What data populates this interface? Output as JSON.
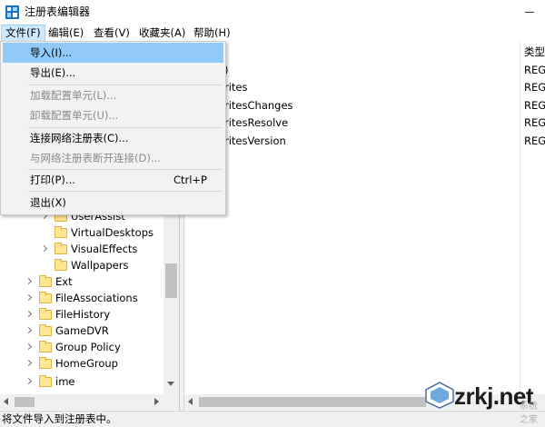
{
  "window": {
    "title": "注册表编辑器"
  },
  "menubar": {
    "items": [
      "文件(F)",
      "编辑(E)",
      "查看(V)",
      "收藏夹(A)",
      "帮助(H)"
    ]
  },
  "file_menu": {
    "items": [
      {
        "label": "导入(I)...",
        "shortcut": "",
        "state": "highlighted"
      },
      {
        "label": "导出(E)...",
        "shortcut": "",
        "state": "enabled"
      },
      {
        "label": "加载配置单元(L)...",
        "shortcut": "",
        "state": "disabled"
      },
      {
        "label": "卸载配置单元(U)...",
        "shortcut": "",
        "state": "disabled"
      },
      {
        "label": "连接网络注册表(C)...",
        "shortcut": "",
        "state": "enabled"
      },
      {
        "label": "与网络注册表断开连接(D)...",
        "shortcut": "",
        "state": "disabled"
      },
      {
        "label": "打印(P)...",
        "shortcut": "Ctrl+P",
        "state": "enabled"
      },
      {
        "label": "退出(X)",
        "shortcut": "",
        "state": "enabled"
      }
    ]
  },
  "tree": {
    "items": [
      {
        "label": "UserAssist",
        "expandable": true
      },
      {
        "label": "VirtualDesktops",
        "expandable": false
      },
      {
        "label": "VisualEffects",
        "expandable": true
      },
      {
        "label": "Wallpapers",
        "expandable": false
      },
      {
        "label": "Ext",
        "expandable": true
      },
      {
        "label": "FileAssociations",
        "expandable": true
      },
      {
        "label": "FileHistory",
        "expandable": true
      },
      {
        "label": "GameDVR",
        "expandable": true
      },
      {
        "label": "Group Policy",
        "expandable": true
      },
      {
        "label": "HomeGroup",
        "expandable": true
      },
      {
        "label": "ime",
        "expandable": true
      }
    ]
  },
  "values_pane": {
    "type_header": "类型",
    "rows": [
      {
        "name": ")",
        "type": "REG"
      },
      {
        "name": "rites",
        "type": "REG"
      },
      {
        "name": "ritesChanges",
        "type": "REG"
      },
      {
        "name": "ritesResolve",
        "type": "REG"
      },
      {
        "name": "ritesVersion",
        "type": "REG"
      }
    ]
  },
  "statusbar": {
    "text": "将文件导入到注册表中。"
  },
  "watermark": {
    "text": "zrkj.net",
    "sub": "系统之家"
  },
  "colors": {
    "menu_highlight": "#91c9f7",
    "menu_bg": "#f2f2f2",
    "folder_fill": "#ffe594",
    "disabled_text": "#8a8a8a"
  }
}
